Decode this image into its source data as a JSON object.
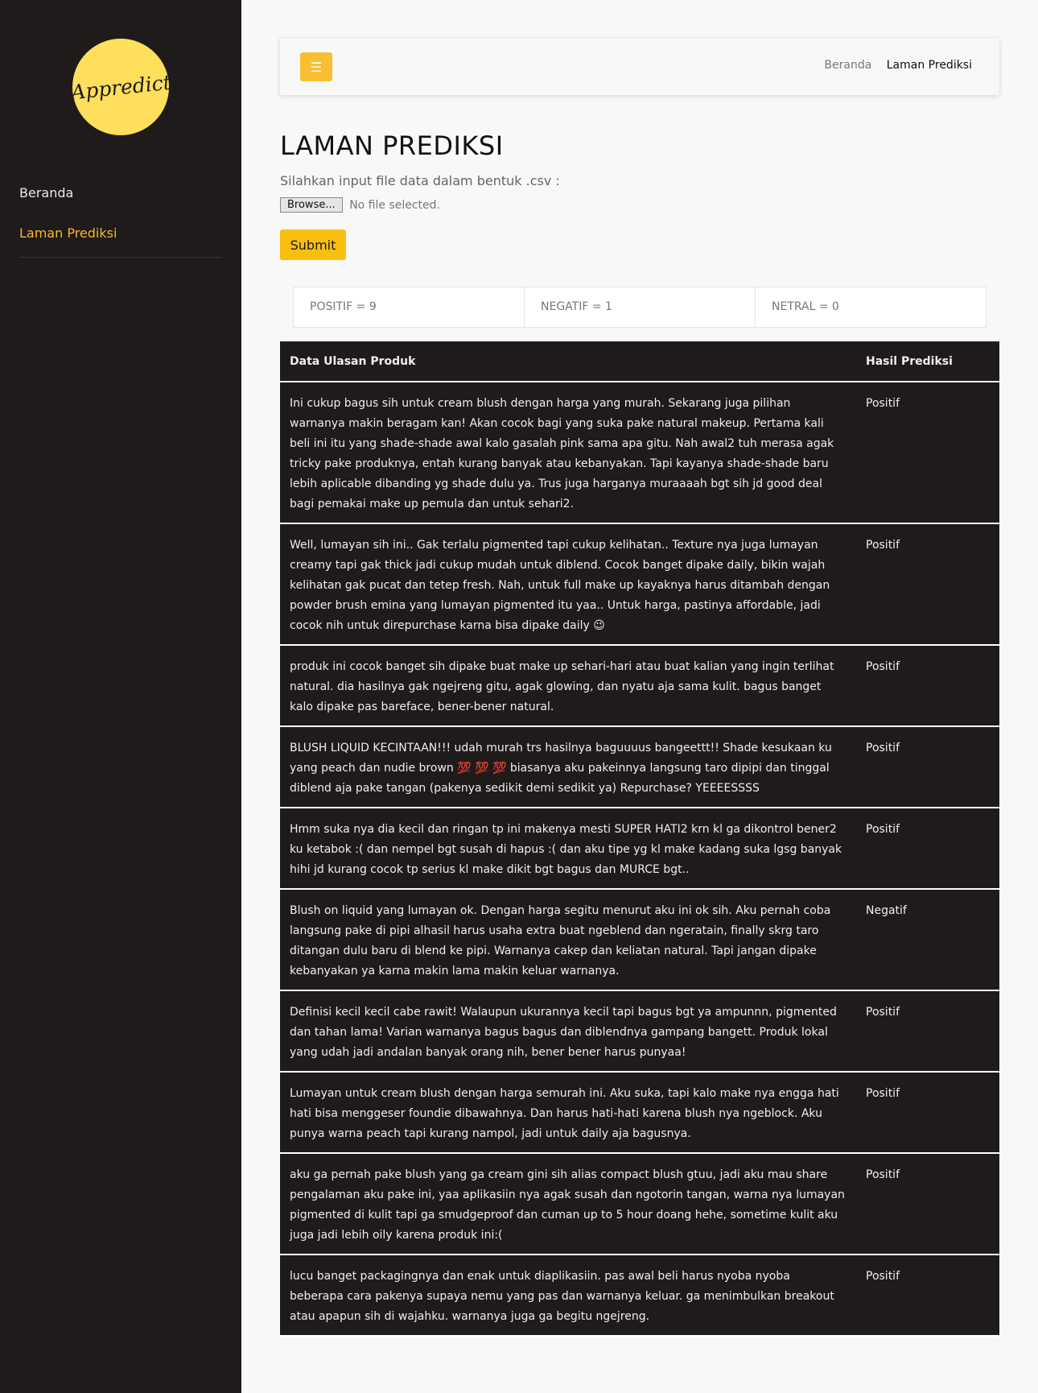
{
  "sidebar": {
    "logo_text": "Appredict",
    "nav": [
      "Beranda",
      "Laman Prediksi"
    ]
  },
  "header": {
    "menu_icon": "bars-icon",
    "breadcrumb": [
      "Beranda",
      "Laman Prediksi"
    ]
  },
  "page": {
    "title": "LAMAN PREDIKSI",
    "instruction": "Silahkan input file data dalam bentuk .csv :",
    "browse_label": "Browse...",
    "file_status": "No file selected.",
    "submit_label": "Submit"
  },
  "stats": [
    "POSITIF = 9",
    "NEGATIF = 1",
    "NETRAL = 0"
  ],
  "colors": {
    "accent": "#f8bf32",
    "sidebar": "#1f1b1b",
    "active_nav": "#f7b731"
  },
  "table": {
    "headers": [
      "Data Ulasan Produk",
      "Hasil Prediksi"
    ],
    "rows": [
      {
        "review": "Ini cukup bagus sih untuk cream blush dengan harga yang murah. Sekarang juga pilihan warnanya makin beragam kan! Akan cocok bagi yang suka pake natural makeup. Pertama kali beli ini itu yang shade-shade awal kalo gasalah pink sama apa gitu. Nah awal2 tuh merasa agak tricky pake produknya, entah kurang banyak atau kebanyakan. Tapi kayanya shade-shade baru lebih aplicable dibanding yg shade dulu ya. Trus juga harganya muraaaah bgt sih jd good deal bagi pemakai make up pemula dan untuk sehari2.",
        "label": "Positif"
      },
      {
        "review": "Well, lumayan sih ini.. Gak terlalu pigmented tapi cukup kelihatan.. Texture nya juga lumayan creamy tapi gak thick jadi cukup mudah untuk diblend. Cocok banget dipake daily, bikin wajah kelihatan gak pucat dan tetep fresh. Nah, untuk full make up kayaknya harus ditambah dengan powder brush emina yang lumayan pigmented itu yaa.. Untuk harga, pastinya affordable, jadi cocok nih untuk direpurchase karna bisa dipake daily 😉",
        "label": "Positif"
      },
      {
        "review": "produk ini cocok banget sih dipake buat make up sehari-hari atau buat kalian yang ingin terlihat natural. dia hasilnya gak ngejreng gitu, agak glowing, dan nyatu aja sama kulit. bagus banget kalo dipake pas bareface, bener-bener natural.",
        "label": "Positif"
      },
      {
        "review": "BLUSH LIQUID KECINTAAN!!! udah murah trs hasilnya baguuuus bangeettt!! Shade kesukaan ku yang peach dan nudie brown 💯 💯 💯 biasanya aku pakeinnya langsung taro dipipi dan tinggal diblend aja pake tangan (pakenya sedikit demi sedikit ya) Repurchase? YEEEESSSS",
        "label": "Positif"
      },
      {
        "review": "Hmm suka nya dia kecil dan ringan tp ini makenya mesti SUPER HATI2 krn kl ga dikontrol bener2 ku ketabok :( dan nempel bgt susah di hapus :( dan aku tipe yg kl make kadang suka lgsg banyak hihi jd kurang cocok tp serius kl make dikit bgt bagus dan MURCE bgt..",
        "label": "Positif"
      },
      {
        "review": "Blush on liquid yang lumayan ok. Dengan harga segitu menurut aku ini ok sih. Aku pernah coba langsung pake di pipi alhasil harus usaha extra buat ngeblend dan ngeratain, finally skrg taro ditangan dulu baru di blend ke pipi. Warnanya cakep dan keliatan natural. Tapi jangan dipake kebanyakan ya karna makin lama makin keluar warnanya.",
        "label": "Negatif"
      },
      {
        "review": "Definisi kecil kecil cabe rawit! Walaupun ukurannya kecil tapi bagus bgt ya ampunnn, pigmented dan tahan lama! Varian warnanya bagus bagus dan diblendnya gampang bangett. Produk lokal yang udah jadi andalan banyak orang nih, bener bener harus punyaa!",
        "label": "Positif"
      },
      {
        "review": "Lumayan untuk cream blush dengan harga semurah ini. Aku suka, tapi kalo make nya engga hati hati bisa menggeser foundie dibawahnya. Dan harus hati-hati karena blush nya ngeblock. Aku punya warna peach tapi kurang nampol, jadi untuk daily aja bagusnya.",
        "label": "Positif"
      },
      {
        "review": "aku ga pernah pake blush yang ga cream gini sih alias compact blush gtuu, jadi aku mau share pengalaman aku pake ini, yaa aplikasiin nya agak susah dan ngotorin tangan, warna nya lumayan pigmented di kulit tapi ga smudgeproof dan cuman up to 5 hour doang hehe, sometime kulit aku juga jadi lebih oily karena produk ini:(",
        "label": "Positif"
      },
      {
        "review": "lucu banget packagingnya dan enak untuk diaplikasiin. pas awal beli harus nyoba nyoba beberapa cara pakenya supaya nemu yang pas dan warnanya keluar. ga menimbulkan breakout atau apapun sih di wajahku. warnanya juga ga begitu ngejreng.",
        "label": "Positif"
      }
    ]
  }
}
